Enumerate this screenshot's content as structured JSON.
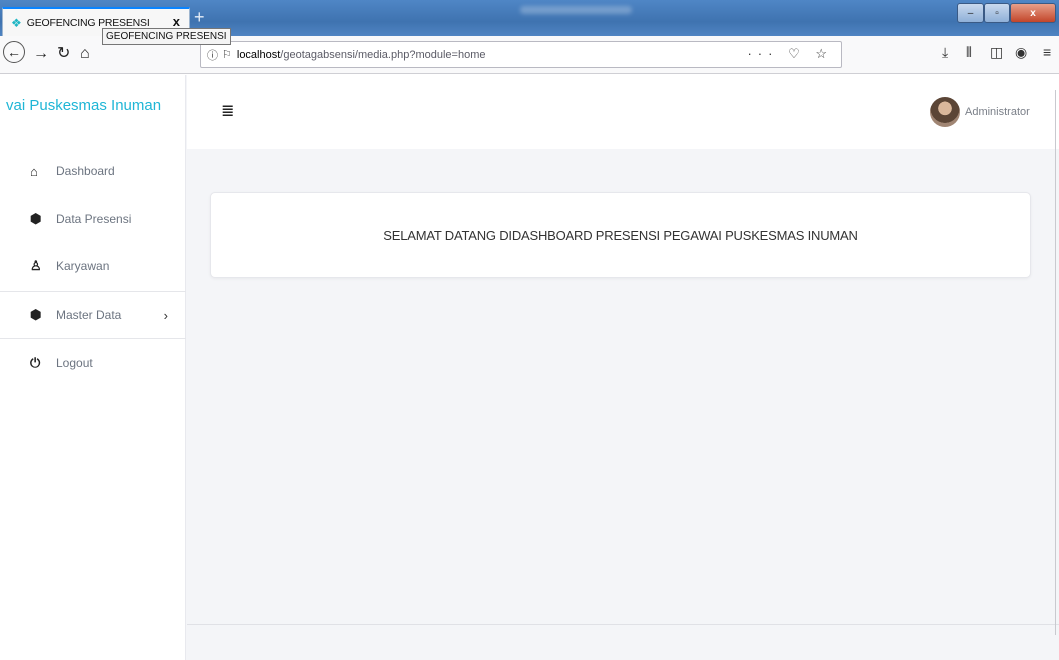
{
  "browser": {
    "tab_title": "GEOFENCING PRESENSI",
    "tab_close": "x",
    "new_tab": "+",
    "tooltip": "GEOFENCING PRESENSI",
    "url_host": "localhost",
    "url_path": "/geotagabsensi/media.php?module=home",
    "url_actions": "··· ♡ ☆",
    "window_min": "–",
    "window_max": "▫",
    "window_close": "x"
  },
  "sidebar": {
    "brand": "vai Puskesmas Inuman",
    "items": [
      {
        "label": "Dashboard",
        "icon": "home-icon",
        "glyph": "⌂"
      },
      {
        "label": "Data Presensi",
        "icon": "cube-icon",
        "glyph": "⬢"
      },
      {
        "label": "Karyawan",
        "icon": "user-icon",
        "glyph": "♙"
      },
      {
        "label": "Master Data",
        "icon": "cube-icon",
        "glyph": "⬢",
        "chevron": "›"
      },
      {
        "label": "Logout",
        "icon": "power-icon",
        "glyph": "⏻"
      }
    ]
  },
  "header": {
    "menu_glyph": "≣",
    "user_name": "Administrator"
  },
  "main": {
    "welcome": "SELAMAT DATANG DIDASHBOARD PRESENSI PEGAWAI PUSKESMAS INUMAN"
  },
  "colors": {
    "brand": "#1fb6d6",
    "background": "#f4f5f8"
  }
}
